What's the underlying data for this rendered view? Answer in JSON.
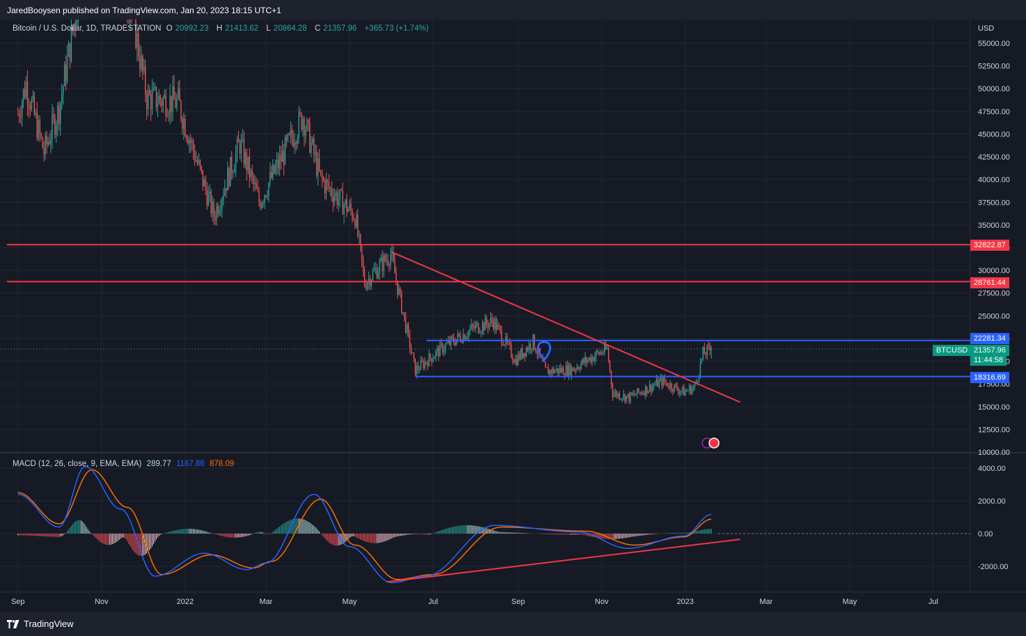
{
  "header": {
    "published": "JaredBooysen published on TradingView.com, Jan 20, 2023 18:15 UTC+1"
  },
  "legend": {
    "symbol": "Bitcoin / U.S. Dollar, 1D, TRADESTATION",
    "open_label": "O",
    "open": "20992.23",
    "high_label": "H",
    "high": "21413.62",
    "low_label": "L",
    "low": "20864.28",
    "close_label": "C",
    "close": "21357.96",
    "change": "+365.73 (+1.74%)"
  },
  "macd_legend": {
    "title": "MACD (12, 26, close, 9, EMA, EMA)",
    "hist": "289.77",
    "macd": "1167.86",
    "signal": "878.09"
  },
  "footer": {
    "brand": "TradingView"
  },
  "price_tags": {
    "level1": "32822.87",
    "level2": "28761.44",
    "level3": "22281.34",
    "level4": "18316.69",
    "symbol": "BTCUSD",
    "last": "21357.96",
    "countdown": "11:44:58"
  },
  "colors": {
    "bg": "#161a25",
    "up": "#26a69a",
    "down": "#ef5350",
    "red_line": "#f23645",
    "blue_line": "#2962ff",
    "macd_line": "#2962ff",
    "signal_line": "#ff6d00"
  },
  "chart_data": [
    {
      "type": "candlestick",
      "title": "Bitcoin / U.S. Dollar, 1D, TRADESTATION",
      "ylabel": "USD",
      "ylim": [
        10000,
        57500
      ],
      "y_ticks": [
        "55000.00",
        "52500.00",
        "50000.00",
        "47500.00",
        "45000.00",
        "42500.00",
        "40000.00",
        "37500.00",
        "35000.00",
        "32500.00",
        "30000.00",
        "27500.00",
        "25000.00",
        "22500.00",
        "20000.00",
        "17500.00",
        "15000.00",
        "12500.00",
        "10000.00"
      ],
      "x_ticks": [
        "Sep",
        "Nov",
        "2022",
        "Mar",
        "May",
        "Jul",
        "Sep",
        "Nov",
        "2023",
        "Mar",
        "May",
        "Jul"
      ],
      "series": [
        {
          "name": "BTCUSD",
          "x": [
            "2021-09-01",
            "2021-09-07",
            "2021-09-20",
            "2021-10-01",
            "2021-10-20",
            "2021-11-10",
            "2021-11-25",
            "2021-12-04",
            "2021-12-27",
            "2022-01-22",
            "2022-02-10",
            "2022-02-24",
            "2022-03-28",
            "2022-04-10",
            "2022-05-05",
            "2022-05-12",
            "2022-05-31",
            "2022-06-13",
            "2022-06-18",
            "2022-07-08",
            "2022-07-30",
            "2022-08-14",
            "2022-08-30",
            "2022-09-12",
            "2022-09-21",
            "2022-10-10",
            "2022-10-29",
            "2022-11-05",
            "2022-11-09",
            "2022-11-21",
            "2022-12-15",
            "2022-12-31",
            "2023-01-08",
            "2023-01-14",
            "2023-01-20"
          ],
          "close": [
            47200,
            50500,
            43000,
            47800,
            64000,
            66500,
            57000,
            49000,
            48500,
            36000,
            44000,
            37500,
            47000,
            40000,
            36000,
            28600,
            31800,
            22500,
            19000,
            21500,
            23600,
            24400,
            20100,
            22200,
            18900,
            19100,
            20800,
            21300,
            16500,
            16000,
            17800,
            16600,
            17200,
            20800,
            21357.96
          ]
        }
      ],
      "annotations": {
        "note": "marker pin near Sep 2022"
      }
    },
    {
      "type": "line",
      "title": "MACD (12, 26, close, 9, EMA, EMA)",
      "ylim": [
        -3000,
        5000
      ],
      "y_ticks": [
        "4000.00",
        "2000.00",
        "0.00",
        "-2000.00"
      ],
      "series": [
        {
          "name": "MACD",
          "x": [
            "2021-09-01",
            "2021-10-01",
            "2021-10-20",
            "2021-11-15",
            "2021-12-10",
            "2022-01-15",
            "2022-02-15",
            "2022-03-01",
            "2022-04-05",
            "2022-05-01",
            "2022-06-01",
            "2022-06-25",
            "2022-08-15",
            "2022-10-15",
            "2022-11-20",
            "2022-12-31",
            "2023-01-20"
          ],
          "values": [
            2400,
            400,
            4100,
            1500,
            -2600,
            -1200,
            -2200,
            -1800,
            2400,
            -800,
            -3000,
            -2600,
            500,
            100,
            -900,
            -150,
            1167.86
          ]
        },
        {
          "name": "Signal",
          "x": [
            "2021-09-01",
            "2021-10-01",
            "2021-10-25",
            "2021-11-20",
            "2021-12-15",
            "2022-01-20",
            "2022-02-20",
            "2022-03-05",
            "2022-04-10",
            "2022-05-05",
            "2022-06-05",
            "2022-07-01",
            "2022-08-20",
            "2022-10-20",
            "2022-11-25",
            "2022-12-31",
            "2023-01-20"
          ],
          "values": [
            2500,
            600,
            3900,
            1600,
            -2500,
            -1300,
            -2100,
            -1700,
            2100,
            -700,
            -2800,
            -2500,
            400,
            150,
            -700,
            -200,
            878.09
          ]
        },
        {
          "name": "Histogram",
          "values": [
            289.77
          ]
        }
      ]
    }
  ]
}
